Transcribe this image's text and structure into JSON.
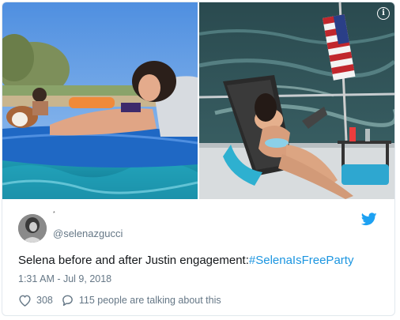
{
  "tweet": {
    "small_mark": "*",
    "handle": "@selenazgucci",
    "text_plain": "Selena before and after Justin engagement:",
    "hashtag": "#SelenaIsFreeParty",
    "timestamp": "1:31 AM - Jul 9, 2018",
    "like_count": "308",
    "reply_label": "115 people are talking about this"
  },
  "icons": {
    "info": "info-icon",
    "brand": "twitter-bird-icon",
    "like": "heart-icon",
    "reply": "speech-bubble-icon"
  },
  "info_glyph": "i",
  "colors": {
    "accent": "#1da1f2",
    "hashtag": "#1b95e0",
    "muted": "#657786",
    "text": "#14171a",
    "border": "#e1e8ed"
  }
}
